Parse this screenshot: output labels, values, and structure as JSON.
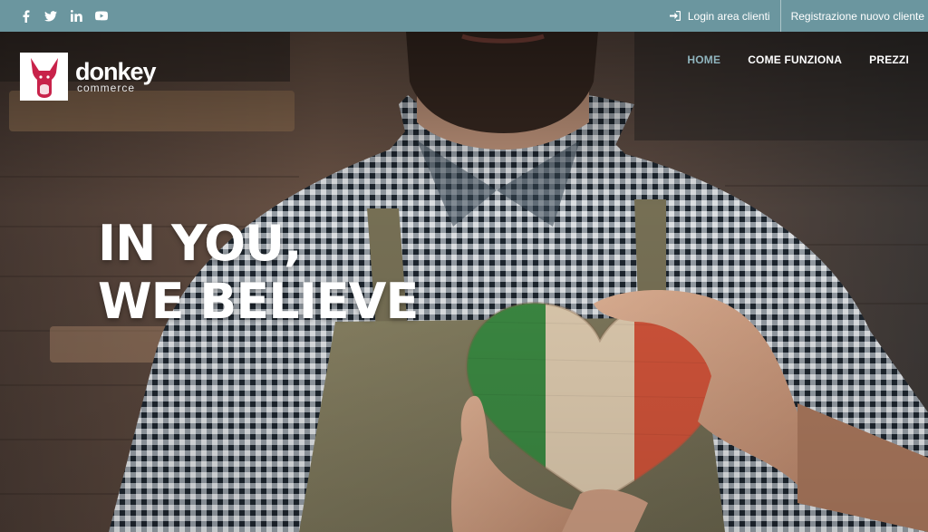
{
  "topbar": {
    "social": [
      {
        "name": "facebook-icon"
      },
      {
        "name": "twitter-icon"
      },
      {
        "name": "linkedin-icon"
      },
      {
        "name": "youtube-icon"
      }
    ],
    "login_label": "Login area clienti",
    "register_label": "Registrazione nuovo cliente",
    "background": "#6b969f"
  },
  "header": {
    "logo": {
      "word": "donkey",
      "sub": "commerce",
      "mark_color": "#c8224a"
    },
    "nav": [
      {
        "label": "HOME",
        "active": true
      },
      {
        "label": "COME FUNZIONA",
        "active": false
      },
      {
        "label": "PREZZI",
        "active": false
      }
    ],
    "active_color": "#8fb4bd"
  },
  "hero": {
    "line1": "IN YOU,",
    "line2": "WE BELIEVE",
    "flag_colors": [
      "#3e8f45",
      "#e7d3b6",
      "#d9573c"
    ]
  }
}
